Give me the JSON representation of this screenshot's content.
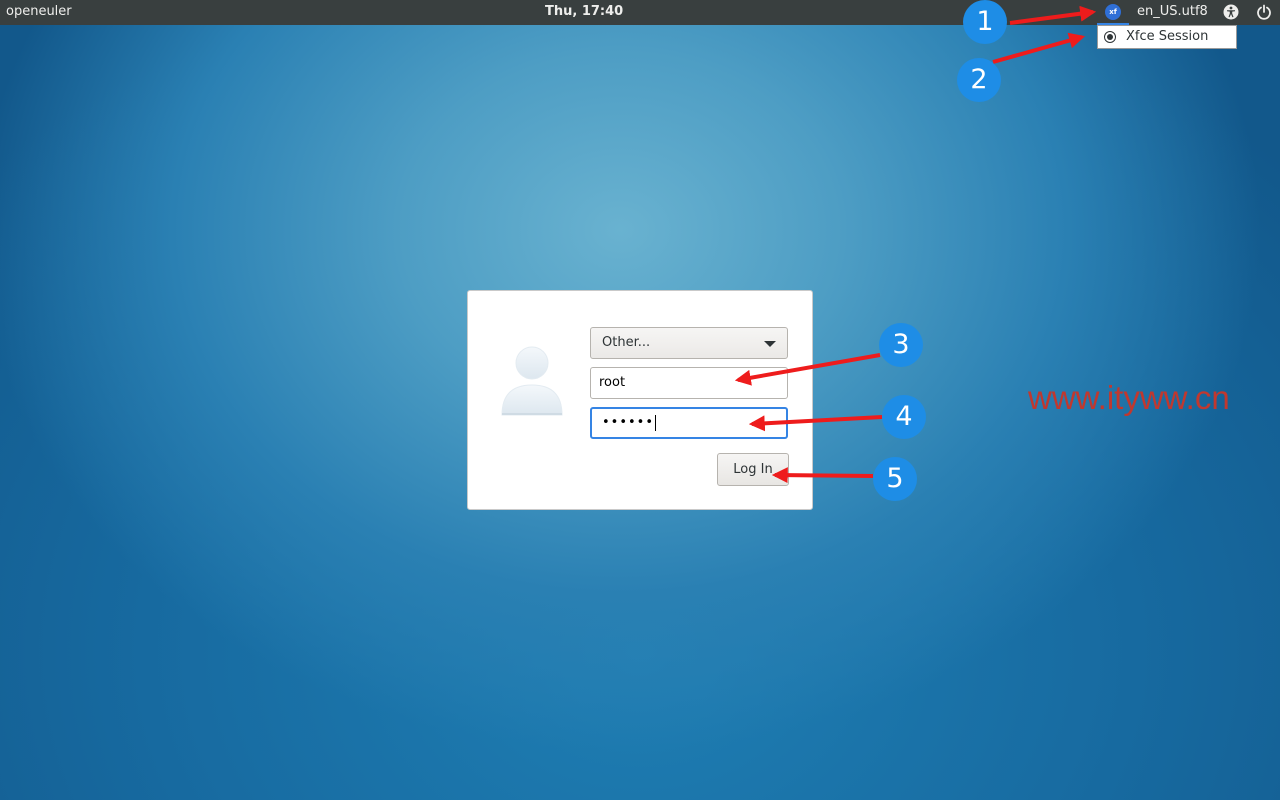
{
  "topbar": {
    "hostname": "openeuler",
    "clock": "Thu, 17:40",
    "language": "en_US.utf8"
  },
  "session_menu": {
    "option_label": "Xfce Session"
  },
  "login": {
    "user_selector_value": "Other...",
    "username_value": "root",
    "password_mask": "••••••",
    "login_button": "Log In"
  },
  "watermark": "www.ityww.cn",
  "annotations": [
    "1",
    "2",
    "3",
    "4",
    "5"
  ],
  "colors": {
    "panel_bg": "#393f3f",
    "focus_accent": "#3584e4",
    "badge": "#1e8de6",
    "arrow": "#ee1c1c"
  }
}
